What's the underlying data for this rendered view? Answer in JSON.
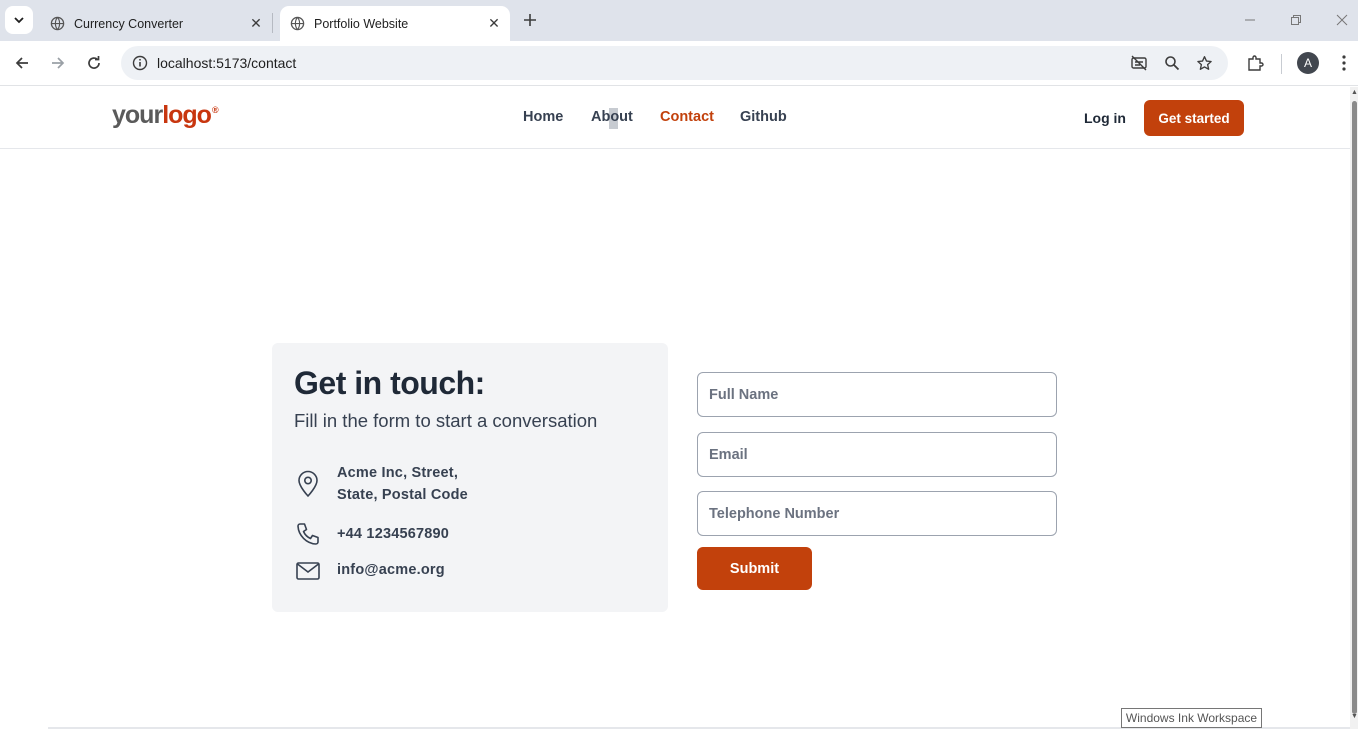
{
  "browser": {
    "tabs": [
      {
        "title": "Currency Converter",
        "active": false
      },
      {
        "title": "Portfolio Website",
        "active": true
      }
    ],
    "address": "localhost:5173/contact",
    "profile_initial": "A"
  },
  "site": {
    "logo": {
      "part1": "your",
      "part2": "logo",
      "mark": "®"
    },
    "nav": [
      {
        "label": "Home",
        "active": false
      },
      {
        "label": "About",
        "active": false
      },
      {
        "label": "Contact",
        "active": true
      },
      {
        "label": "Github",
        "active": false
      }
    ],
    "login_label": "Log in",
    "cta_label": "Get started"
  },
  "contact": {
    "title": "Get in touch:",
    "subtitle": "Fill in the form to start a conversation",
    "address_line1": "Acme Inc, Street,",
    "address_line2": "State, Postal Code",
    "phone": "+44 1234567890",
    "email": "info@acme.org"
  },
  "form": {
    "full_name_placeholder": "Full Name",
    "email_placeholder": "Email",
    "phone_placeholder": "Telephone Number",
    "submit_label": "Submit"
  },
  "colors": {
    "accent": "#c2410c",
    "card_bg": "#f3f4f6",
    "text_dark": "#1f2937"
  },
  "os_tooltip": "Windows Ink Workspace"
}
